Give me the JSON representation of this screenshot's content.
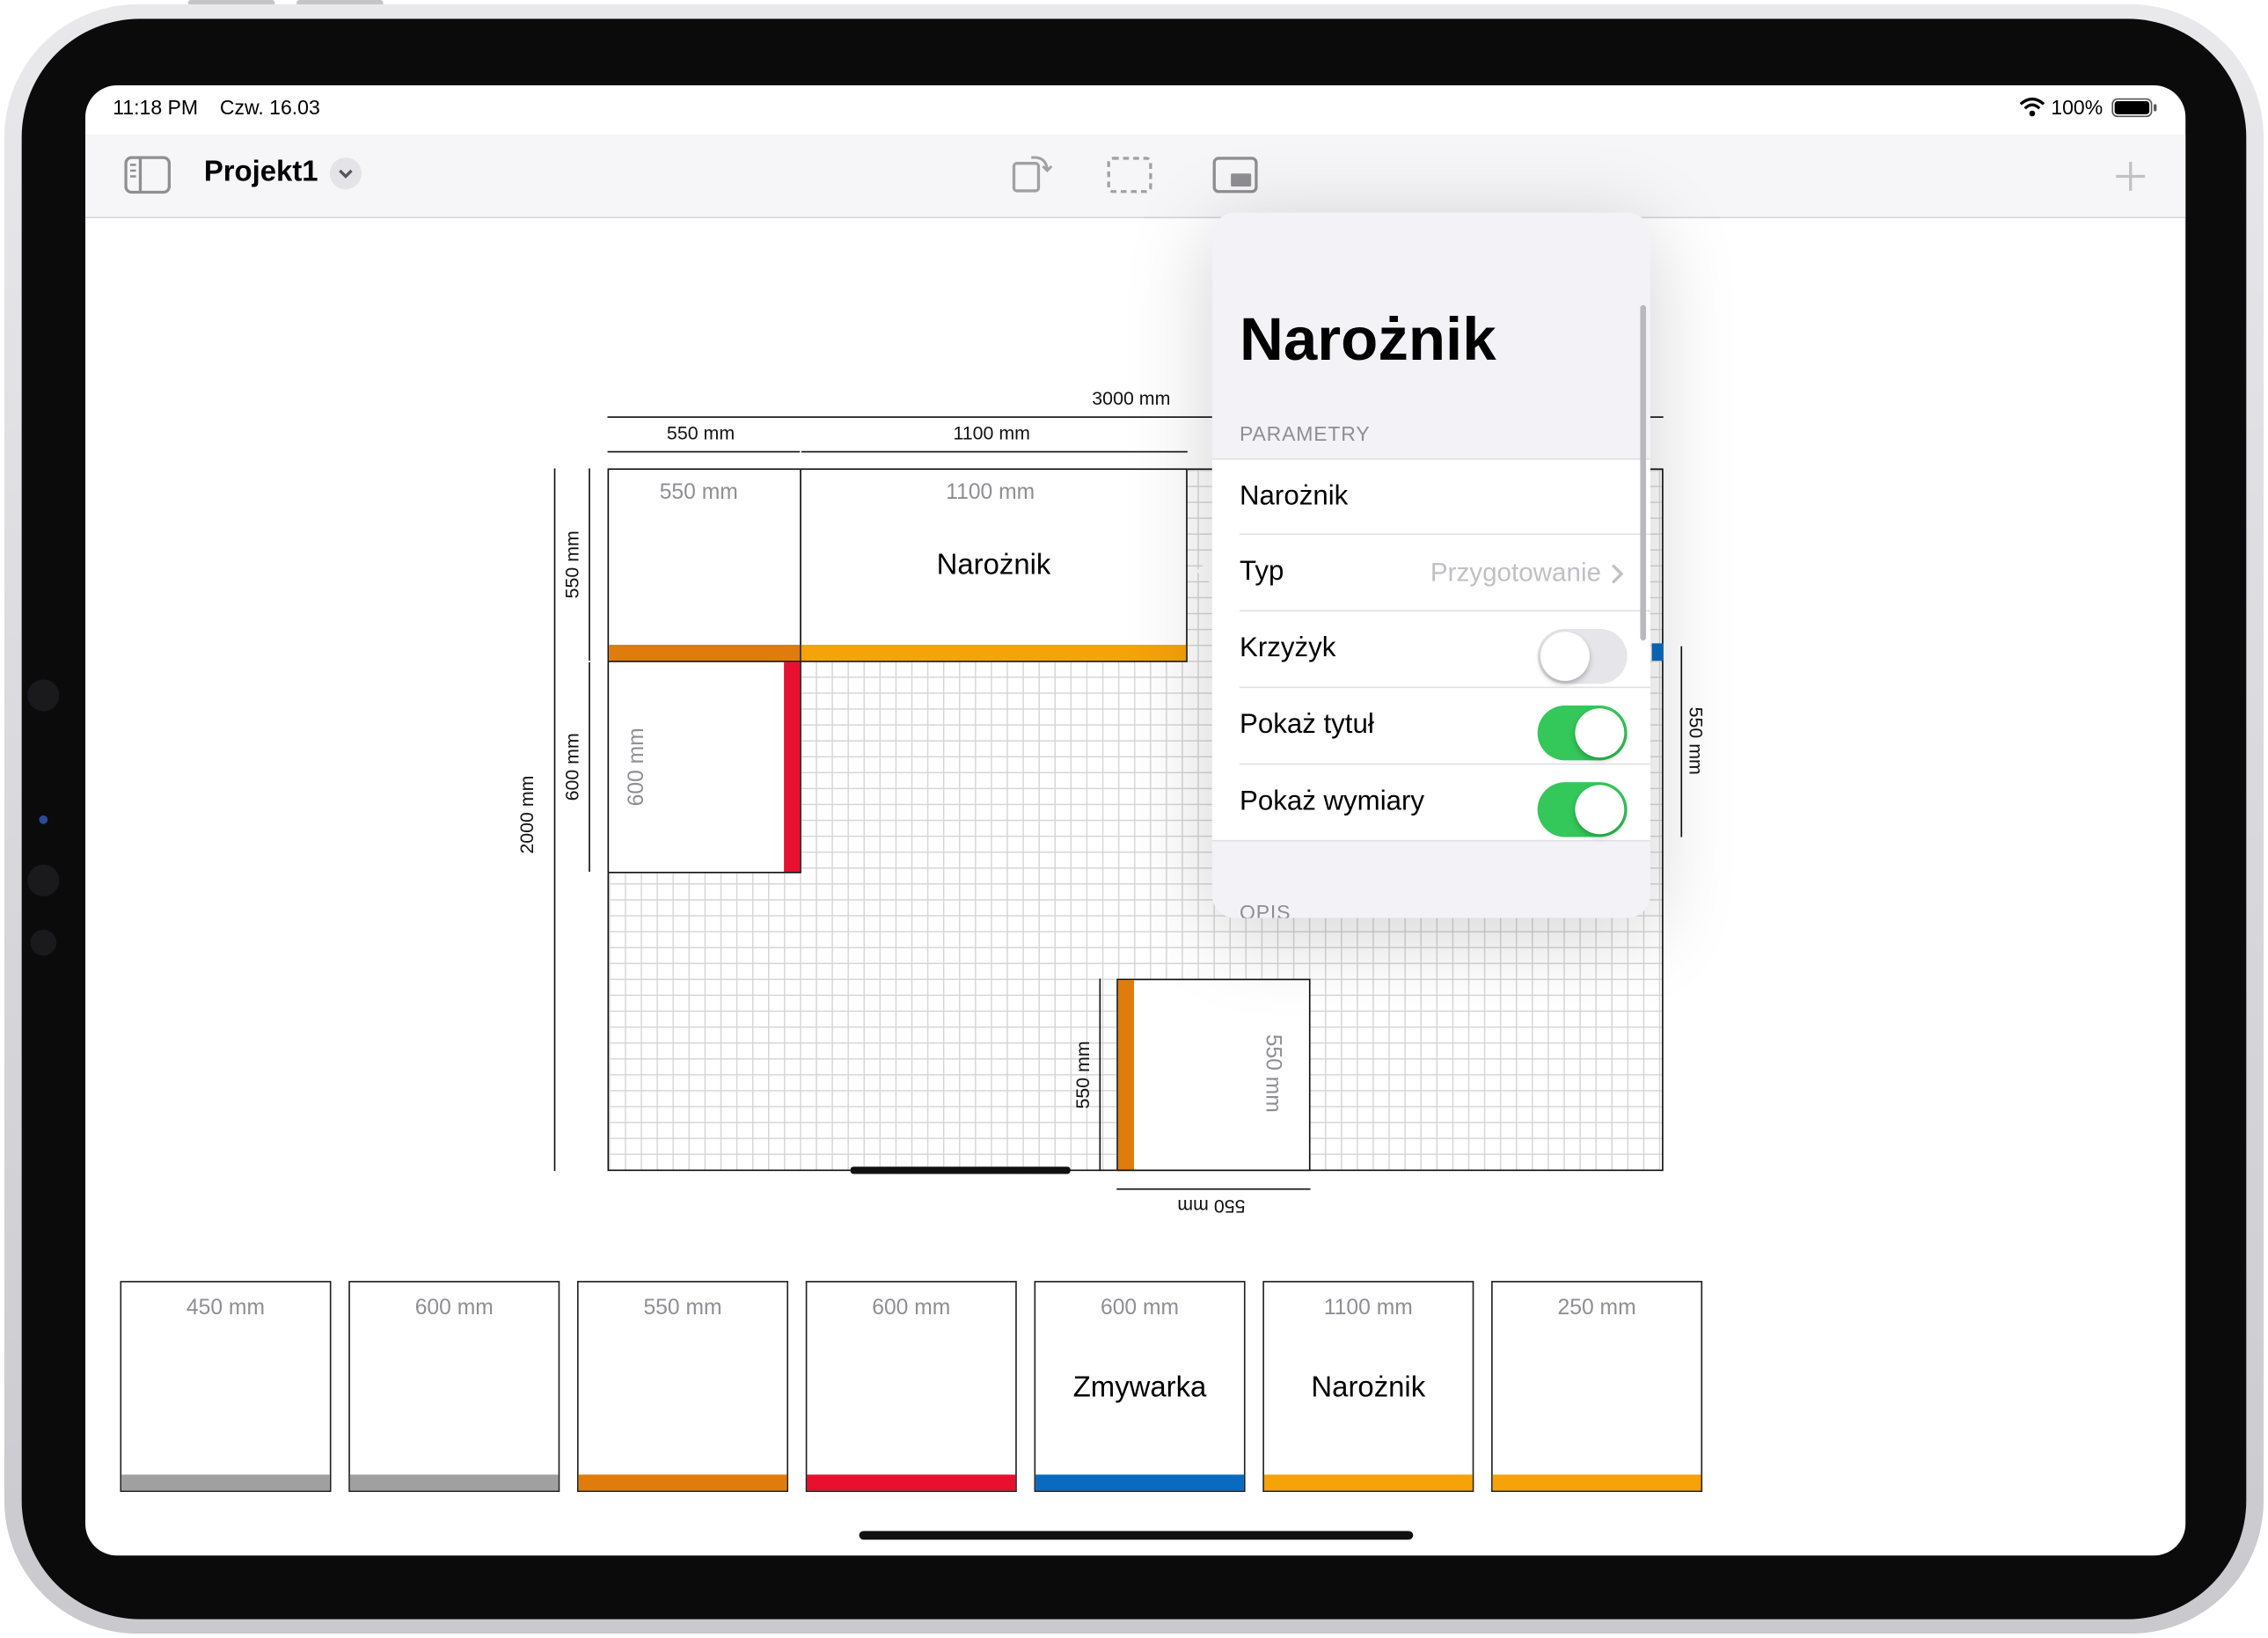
{
  "status_bar": {
    "time": "11:18 PM",
    "date": "Czw. 16.03",
    "battery": "100%"
  },
  "nav": {
    "title": "Projekt1"
  },
  "icons": {
    "sidebar": "sidebar-icon",
    "dropdown": "chevron-down-icon",
    "rotate": "rotate-icon",
    "select": "selection-rect-icon",
    "view": "view-mode-icon",
    "add": "plus-icon",
    "wifi": "wifi-icon",
    "battery": "battery-icon"
  },
  "plan": {
    "dim_total_width": "3000 mm",
    "dim_top_left": "550 mm",
    "dim_top_right": "1100 mm",
    "dim_left_top": "550 mm",
    "dim_left_mid": "600 mm",
    "dim_total_height": "2000 mm",
    "dim_right": "550 mm",
    "dim_bottom_cab_v": "550 mm",
    "dim_bottom_cab_h": "550 mm",
    "cabinets": [
      {
        "id": "c1",
        "width_label": "550 mm",
        "name": "",
        "color": "#e07b0e"
      },
      {
        "id": "c2",
        "width_label": "1100 mm",
        "name": "Narożnik",
        "color": "#f6a209"
      },
      {
        "id": "c3",
        "width_label": "600 mm",
        "name": "",
        "color": "#e8102e"
      },
      {
        "id": "c4",
        "width_label": "550 mm",
        "name": "",
        "color": "#e07b0e"
      }
    ]
  },
  "popover": {
    "title": "Narożnik",
    "section_params": "PARAMETRY",
    "name_value": "Narożnik",
    "type_label": "Typ",
    "type_value": "Przygotowanie",
    "cross_label": "Krzyżyk",
    "cross_on": false,
    "show_title_label": "Pokaż tytuł",
    "show_title_on": true,
    "show_dims_label": "Pokaż wymiary",
    "show_dims_on": true,
    "section_desc": "OPIS"
  },
  "library": [
    {
      "size": "450 mm",
      "name": "",
      "color": "#a0a0a0"
    },
    {
      "size": "600 mm",
      "name": "",
      "color": "#a0a0a0"
    },
    {
      "size": "550 mm",
      "name": "",
      "color": "#e07b0e"
    },
    {
      "size": "600 mm",
      "name": "",
      "color": "#e8102e"
    },
    {
      "size": "600 mm",
      "name": "Zmywarka",
      "color": "#0a6ac0"
    },
    {
      "size": "1100 mm",
      "name": "Narożnik",
      "color": "#f6a209"
    },
    {
      "size": "250 mm",
      "name": "",
      "color": "#f6a209"
    }
  ],
  "colors": {
    "toggle_on": "#34c759",
    "toggle_off": "#e5e5ea",
    "accent_blue": "#0a6ac0"
  }
}
